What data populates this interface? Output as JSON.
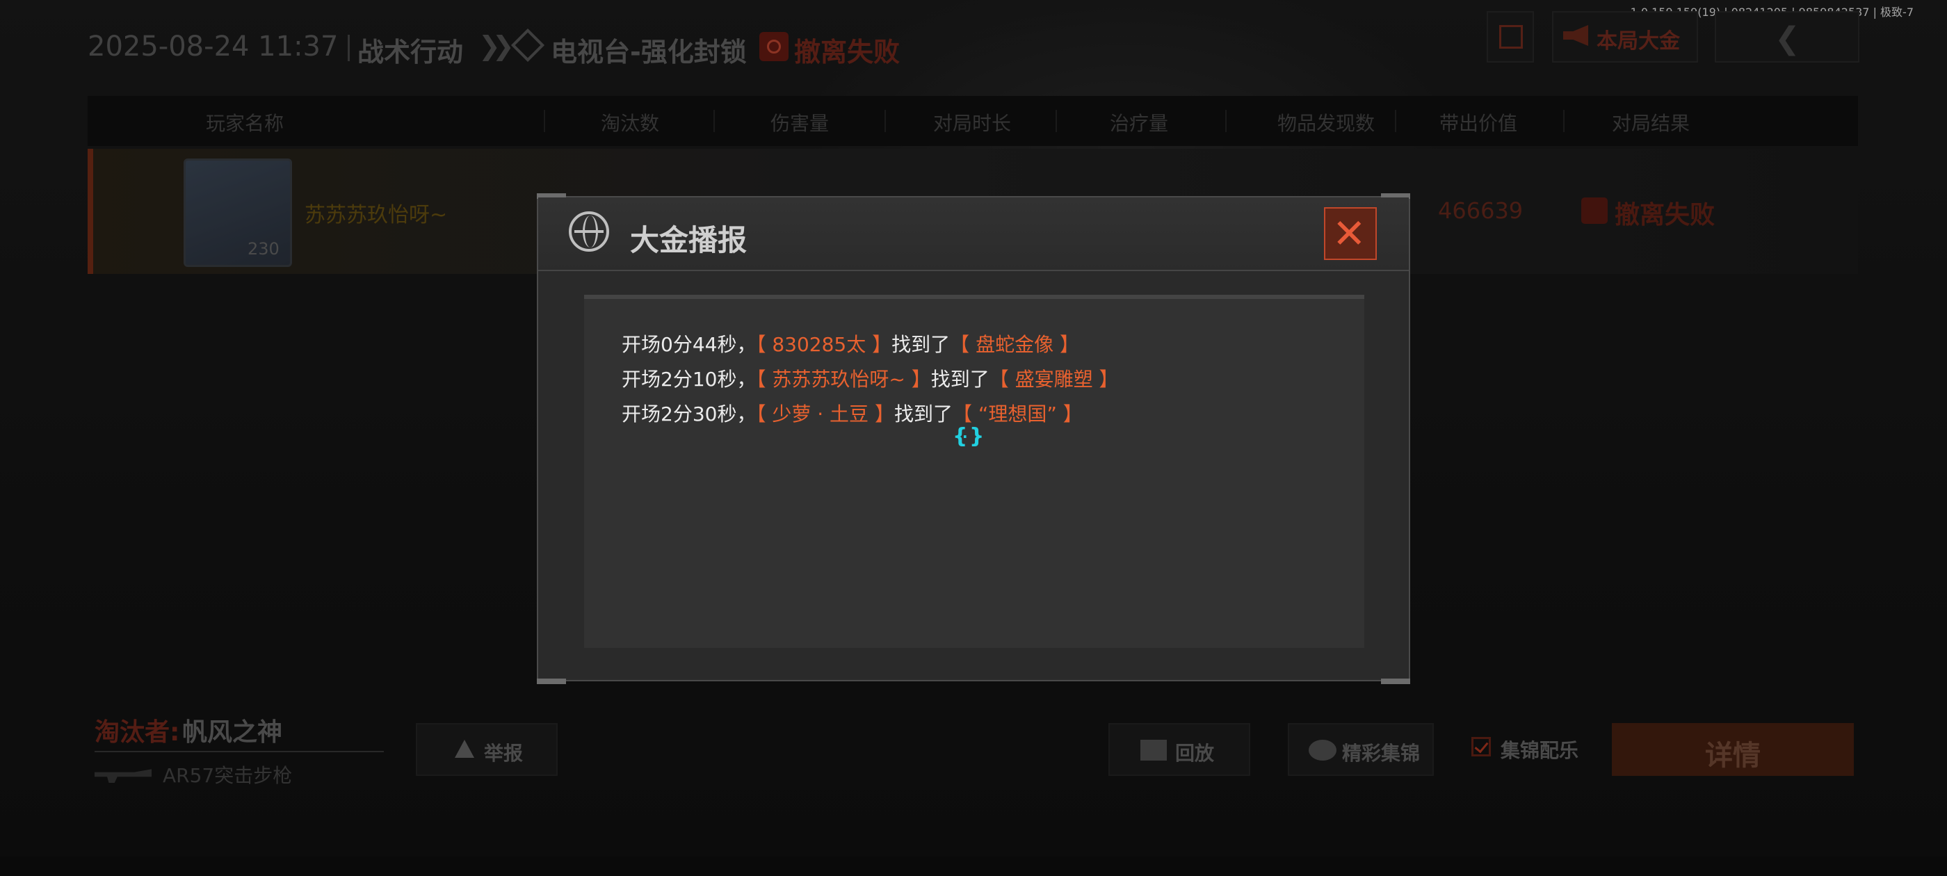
{
  "version": "1.0.159.159(19) | 08241205 | 9859842537 | 极致-7",
  "header": {
    "datetime": "2025-08-24 11:37",
    "mode": "战术行动",
    "chevrons": "❯❯",
    "map": "电视台-强化封锁",
    "result": "撤离失败",
    "broadcast_button": "本局大金",
    "back_glyph": "❮"
  },
  "table": {
    "columns": [
      "玩家名称",
      "淘汰数",
      "伤害量",
      "对局时长",
      "治疗量",
      "物品发现数",
      "带出价值",
      "对局结果"
    ],
    "row": {
      "player": "苏苏苏玖怡呀~",
      "level": "230",
      "value": "466639",
      "result": "撤离失败"
    }
  },
  "modal": {
    "title": "大金播报",
    "close_glyph": "✕",
    "entries": [
      {
        "time": "开场0分44秒，",
        "player": "【 830285太 】",
        "verb": "找到了",
        "item": "【 盘蛇金像 】"
      },
      {
        "time": "开场2分10秒，",
        "player": "【 苏苏苏玖怡呀~ 】",
        "verb": "找到了",
        "item": "【 盛宴雕塑 】"
      },
      {
        "time": "开场2分30秒，",
        "player": "【 少萝 · 土豆 】",
        "verb": "找到了",
        "item": "【 “理想国” 】"
      }
    ]
  },
  "bottom": {
    "killer_label": "淘汰者:",
    "killer": "帆风之神",
    "weapon": "AR57突击步枪",
    "report": "举报",
    "replay": "回放",
    "highlights": "精彩集锦",
    "music": "集锦配乐",
    "music_checked": true,
    "detail": "详情"
  },
  "colors": {
    "accent": "#e8612f",
    "text": "#ececec",
    "cursor": "#22d0e0"
  }
}
